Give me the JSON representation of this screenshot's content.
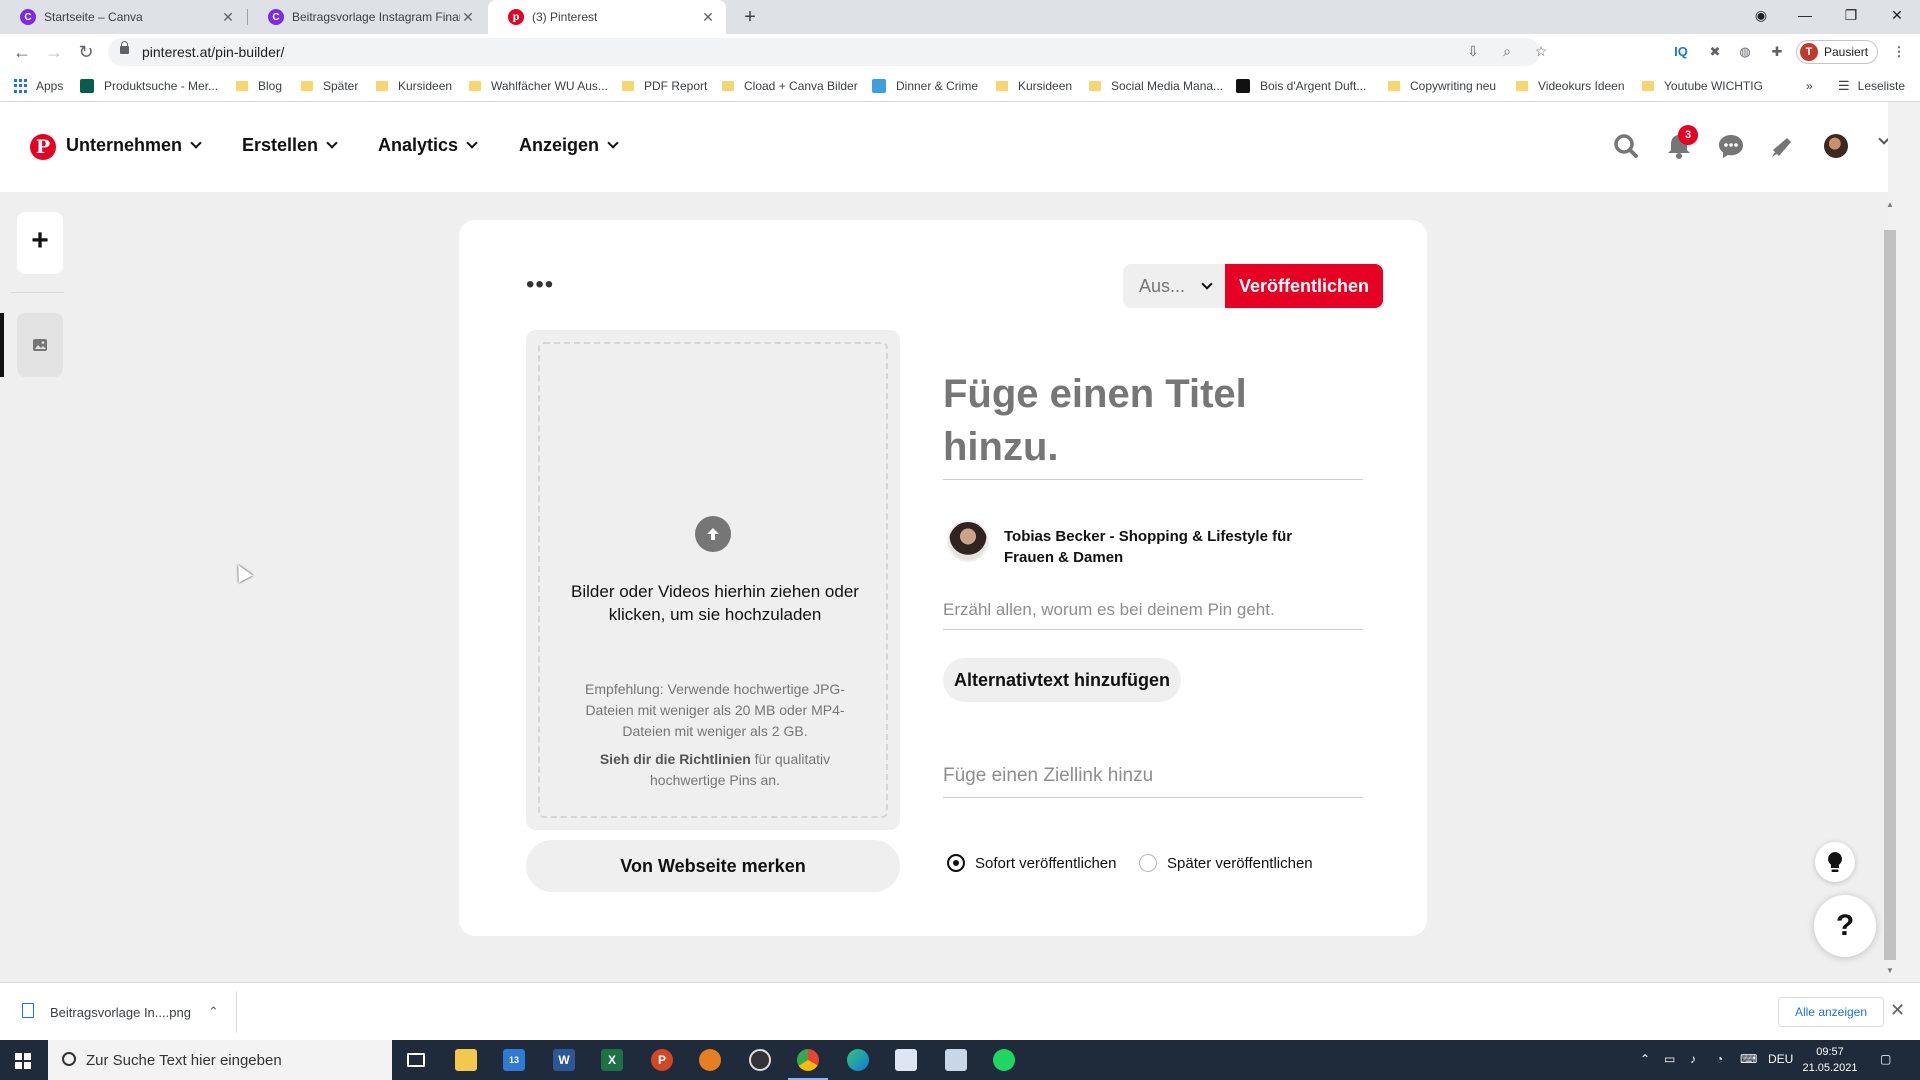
{
  "browser": {
    "tabs": [
      {
        "title": "Startseite – Canva",
        "active": false
      },
      {
        "title": "Beitragsvorlage Instagram Finanz",
        "active": false
      },
      {
        "title": "(3) Pinterest",
        "active": true
      }
    ],
    "url": "pinterest.at/pin-builder/",
    "profile_label": "Pausiert",
    "profile_initial": "T",
    "bookmarks": [
      "Apps",
      "Produktsuche - Mer...",
      "Blog",
      "Später",
      "Kursideen",
      "Wahlfächer WU Aus...",
      "PDF Report",
      "Cload + Canva Bilder",
      "Dinner & Crime",
      "Kursideen",
      "Social Media Mana...",
      "Bois d'Argent Duft...",
      "Copywriting neu",
      "Videokurs Ideen",
      "Youtube WICHTIG"
    ],
    "bookmarks_overflow": "»",
    "reading_list": "Leseliste"
  },
  "pinterest": {
    "nav": [
      "Unternehmen",
      "Erstellen",
      "Analytics",
      "Anzeigen"
    ],
    "notification_count": "3",
    "accent_color": "#e60023"
  },
  "pin_builder": {
    "more_options": "•••",
    "board_select": "Aus...",
    "publish_label": "Veröffentlichen",
    "upload_text": "Bilder oder Videos hierhin ziehen oder klicken, um sie hochzuladen",
    "upload_hint": "Empfehlung: Verwende hochwertige JPG-Dateien mit weniger als 20 MB oder MP4-Dateien mit weniger als 2 GB.",
    "guidelines_link": "Sieh dir die Richtlinien",
    "guidelines_rest": " für qualitativ hochwertige Pins an.",
    "save_from_web": "Von Webseite merken",
    "title_placeholder": "Füge einen Titel hinzu.",
    "author_name": "Tobias Becker - Shopping & Lifestyle für Frauen & Damen",
    "description_placeholder": "Erzähl allen, worum es bei deinem Pin geht.",
    "alt_text_button": "Alternativtext hinzufügen",
    "link_placeholder": "Füge einen Ziellink hinzu",
    "publish_now": "Sofort veröffentlichen",
    "publish_later": "Später veröffentlichen",
    "publish_now_selected": true
  },
  "floating": {
    "help_label": "?"
  },
  "download_shelf": {
    "file_name": "Beitragsvorlage In....png",
    "show_all": "Alle anzeigen"
  },
  "taskbar": {
    "search_placeholder": "Zur Suche Text hier eingeben",
    "mail_badge": "13",
    "language": "DEU",
    "time": "09:57",
    "date": "21.05.2021"
  }
}
